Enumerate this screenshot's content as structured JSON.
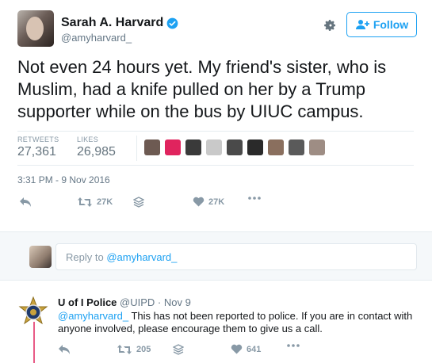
{
  "tweet": {
    "display_name": "Sarah A. Harvard",
    "handle": "@amyharvard_",
    "follow_label": "Follow",
    "text": "Not even 24 hours yet. My friend's sister, who is Muslim, had a knife pulled on her by a Trump supporter while on the bus by UIUC campus.",
    "retweets_label": "RETWEETS",
    "retweets_count": "27,361",
    "likes_label": "LIKES",
    "likes_count": "26,985",
    "timestamp": "3:31 PM - 9 Nov 2016",
    "actions": {
      "reply_icon": "reply-icon",
      "retweet_icon": "retweet-icon",
      "retweet_count": "27K",
      "stack_icon": "stack-icon",
      "like_icon": "heart-icon",
      "like_count": "27K",
      "more_icon": "more-icon"
    },
    "liker_colors": [
      "#6d5a52",
      "#e0245e",
      "#3a3a3a",
      "#c9c9c9",
      "#4a4a4a",
      "#2a2a2a",
      "#8a6f5e",
      "#5a5a5a",
      "#9e8d84"
    ]
  },
  "reply_box": {
    "prefix": "Reply to",
    "mention": "@amyharvard_"
  },
  "reply_tweet": {
    "display_name": "U of I Police",
    "handle": "@UIPD",
    "dot": "·",
    "time": "Nov 9",
    "mention": "@amyharvard_",
    "text": " This has not been reported to police. If you are in contact with anyone involved, please encourage them to give us a call.",
    "retweet_count": "205",
    "like_count": "641"
  },
  "colors": {
    "accent": "#1da1f2",
    "muted": "#8899a6",
    "thread": "#e0245e"
  }
}
